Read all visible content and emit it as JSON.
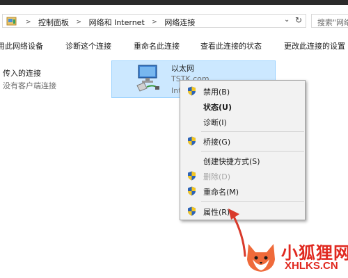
{
  "breadcrumbs": [
    "控制面板",
    "网络和 Internet",
    "网络连接"
  ],
  "search": {
    "placeholder": "搜索\"网络"
  },
  "commands": [
    "用此网络设备",
    "诊断这个连接",
    "重命名此连接",
    "查看此连接的状态",
    "更改此连接的设置"
  ],
  "section": {
    "title": "传入的连接",
    "subtitle": "没有客户端连接"
  },
  "adapter": {
    "name": "以太网",
    "line1": "TSTK.com",
    "line2": "Int"
  },
  "context_menu": {
    "items": [
      {
        "label": "禁用(B)",
        "shield": true,
        "bold": false,
        "disabled": false
      },
      {
        "label": "状态(U)",
        "shield": false,
        "bold": true,
        "disabled": false
      },
      {
        "label": "诊断(I)",
        "shield": false,
        "bold": false,
        "disabled": false
      },
      {
        "label": "桥接(G)",
        "shield": true,
        "bold": false,
        "disabled": false
      },
      {
        "label": "创建快捷方式(S)",
        "shield": false,
        "bold": false,
        "disabled": false
      },
      {
        "label": "删除(D)",
        "shield": true,
        "bold": false,
        "disabled": true
      },
      {
        "label": "重命名(M)",
        "shield": true,
        "bold": false,
        "disabled": false
      },
      {
        "label": "属性(R)",
        "shield": true,
        "bold": false,
        "disabled": false
      }
    ]
  },
  "watermark": {
    "cn": "小狐狸网",
    "en": "XHLKS.CN"
  },
  "colors": {
    "selection": "#cce8ff",
    "selection_border": "#99d1ff",
    "menu_bg": "#f2f2f2",
    "arrow": "#d93a2b",
    "watermark": "#e0281f"
  }
}
